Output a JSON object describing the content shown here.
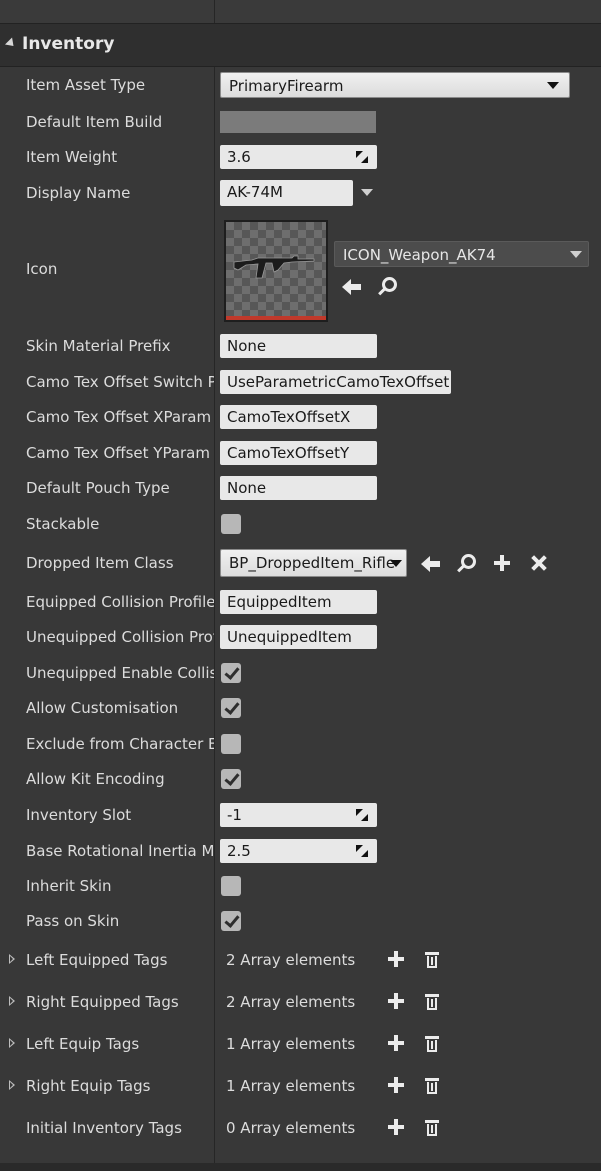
{
  "category": {
    "title": "Inventory"
  },
  "rows": {
    "item_asset_type": {
      "label": "Item Asset Type",
      "value": "PrimaryFirearm"
    },
    "default_item_build": {
      "label": "Default Item Build"
    },
    "item_weight": {
      "label": "Item Weight",
      "value": "3.6"
    },
    "display_name": {
      "label": "Display Name",
      "value": "AK-74M"
    },
    "icon": {
      "label": "Icon",
      "asset": "ICON_Weapon_AK74"
    },
    "skin_material_prefix": {
      "label": "Skin Material Prefix",
      "value": "None"
    },
    "camo_switch": {
      "label": "Camo Tex Offset Switch Pa",
      "value": "UseParametricCamoTexOffset"
    },
    "camo_x": {
      "label": "Camo Tex Offset XParam",
      "value": "CamoTexOffsetX"
    },
    "camo_y": {
      "label": "Camo Tex Offset YParam",
      "value": "CamoTexOffsetY"
    },
    "default_pouch_type": {
      "label": "Default Pouch Type",
      "value": "None"
    },
    "stackable": {
      "label": "Stackable",
      "checked": false
    },
    "dropped_item_class": {
      "label": "Dropped Item Class",
      "value": "BP_DroppedItem_Rifle"
    },
    "equipped_collision": {
      "label": "Equipped Collision Profile N",
      "value": "EquippedItem"
    },
    "unequipped_collision": {
      "label": "Unequipped Collision Profi",
      "value": "UnequippedItem"
    },
    "unequipped_enable_collision": {
      "label": "Unequipped Enable Collisio",
      "checked": true
    },
    "allow_customisation": {
      "label": "Allow Customisation",
      "checked": true
    },
    "exclude_from_character_editor": {
      "label": "Exclude from Character Ed",
      "checked": false
    },
    "allow_kit_encoding": {
      "label": "Allow Kit Encoding",
      "checked": true
    },
    "inventory_slot": {
      "label": "Inventory Slot",
      "value": "-1"
    },
    "base_rotational_inertia": {
      "label": "Base Rotational Inertia Mo",
      "value": "2.5"
    },
    "inherit_skin": {
      "label": "Inherit Skin",
      "checked": false
    },
    "pass_on_skin": {
      "label": "Pass on Skin",
      "checked": true
    },
    "left_equipped_tags": {
      "label": "Left Equipped Tags",
      "value": "2 Array elements"
    },
    "right_equipped_tags": {
      "label": "Right Equipped Tags",
      "value": "2 Array elements"
    },
    "left_equip_tags": {
      "label": "Left Equip Tags",
      "value": "1 Array elements"
    },
    "right_equip_tags": {
      "label": "Right Equip Tags",
      "value": "1 Array elements"
    },
    "initial_inventory_tags": {
      "label": "Initial Inventory Tags",
      "value": "0 Array elements"
    }
  },
  "icons": [
    "expand-arrow-icon",
    "dropdown-caret-icon",
    "spinner-icon",
    "checkmark-icon",
    "use-selected-arrow-icon",
    "browse-magnifier-icon",
    "add-plus-icon",
    "clear-x-icon",
    "trash-icon",
    "expand-triangle-icon"
  ],
  "colors": {
    "background": "#383838",
    "category_bar": "#2f2f2f",
    "field": "#e8e8e8",
    "thumbnail_border_accent": "#c0392b"
  }
}
